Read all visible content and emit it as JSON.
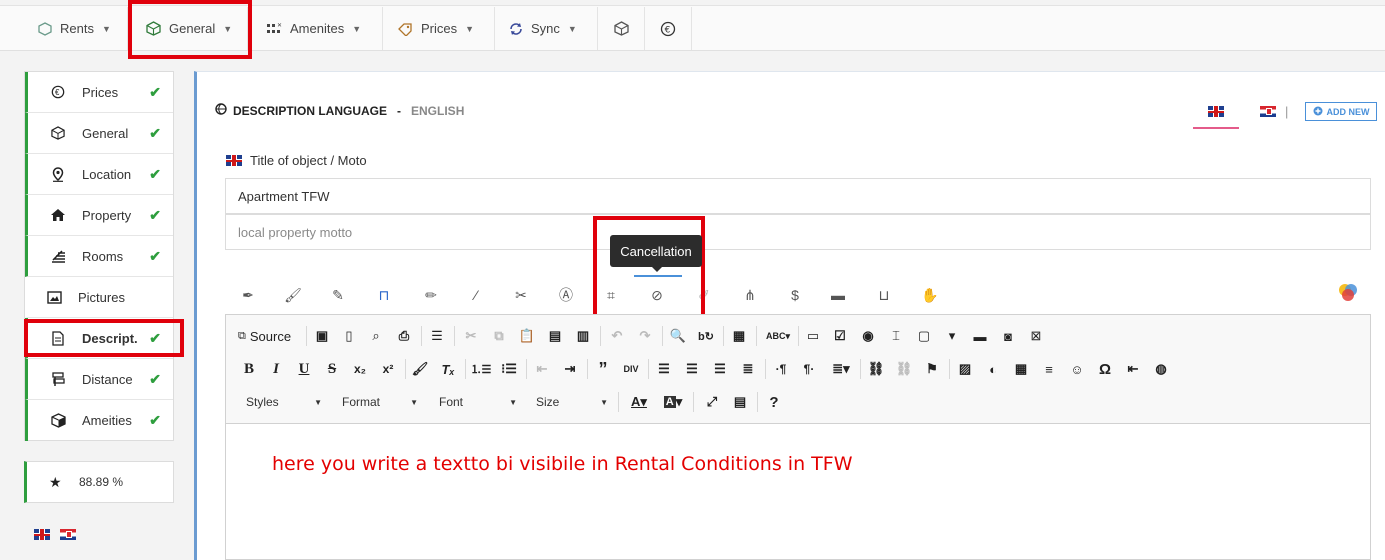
{
  "topnav": {
    "items": [
      {
        "label": "Rents",
        "icon": "hexagon-icon"
      },
      {
        "label": "General",
        "icon": "cube-icon"
      },
      {
        "label": "Amenites",
        "icon": "grid-icon"
      },
      {
        "label": "Prices",
        "icon": "tag-icon"
      },
      {
        "label": "Sync",
        "icon": "sync-icon"
      }
    ],
    "extra_icons": [
      "cube-icon",
      "euro-icon"
    ]
  },
  "sidebar": {
    "items": [
      {
        "label": "Prices",
        "done": true
      },
      {
        "label": "General",
        "done": true
      },
      {
        "label": "Location",
        "done": true
      },
      {
        "label": "Property",
        "done": true
      },
      {
        "label": "Rooms",
        "done": true
      },
      {
        "label": "Pictures",
        "done": false
      },
      {
        "label": "Descript.",
        "done": true
      },
      {
        "label": "Distance",
        "done": true
      },
      {
        "label": "Ameities",
        "done": true
      }
    ],
    "check": "✔",
    "score": "88.89 %"
  },
  "description": {
    "heading": "DESCRIPTION LANGUAGE",
    "separator": "-",
    "language": "ENGLISH",
    "add_new": "ADD NEW",
    "divider": "|"
  },
  "form": {
    "title_label": "Title of object / Moto",
    "title_value": "Apartment TFW",
    "motto_placeholder": "local property motto"
  },
  "tooltip": "Cancellation",
  "editor": {
    "source_label": "Source",
    "styles": "Styles",
    "format": "Format",
    "font": "Font",
    "size": "Size",
    "content": "here you write a textto bi visibile in Rental Conditions in TFW"
  },
  "colors": {
    "accent_green": "#2e9e3e",
    "highlight_red": "#e0000b",
    "link_blue": "#4a90d9"
  }
}
